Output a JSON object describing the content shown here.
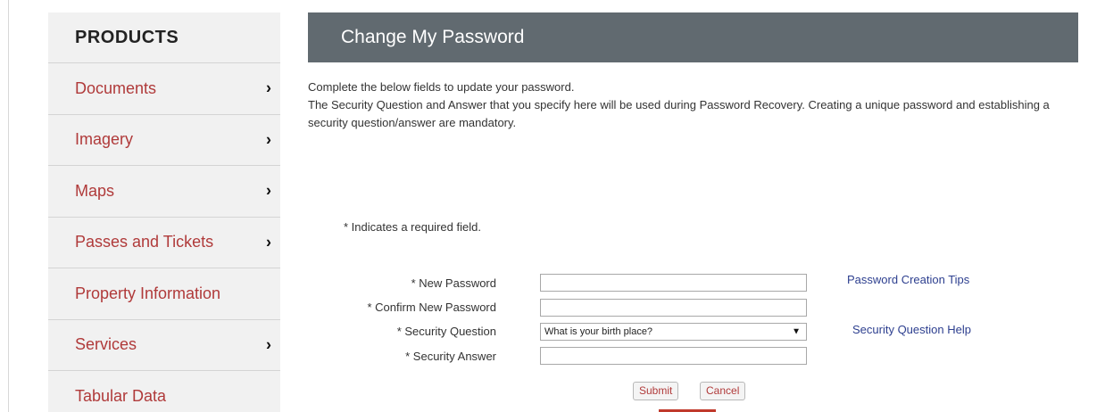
{
  "sidebar": {
    "header": "PRODUCTS",
    "items": [
      {
        "label": "Documents",
        "has_chevron": true
      },
      {
        "label": "Imagery",
        "has_chevron": true
      },
      {
        "label": "Maps",
        "has_chevron": true
      },
      {
        "label": "Passes and Tickets",
        "has_chevron": true
      },
      {
        "label": "Property Information",
        "has_chevron": false
      },
      {
        "label": "Services",
        "has_chevron": true
      },
      {
        "label": "Tabular Data",
        "has_chevron": false
      }
    ],
    "chevron_glyph": "›"
  },
  "main": {
    "title": "Change My Password",
    "intro_line1": "Complete the below fields to update your password.",
    "intro_line2": "The Security Question and Answer that you specify here will be used during Password Recovery. Creating a unique password and establishing a security question/answer are mandatory.",
    "required_note": "* Indicates a required field."
  },
  "form": {
    "new_password_label": "* New Password",
    "confirm_password_label": "* Confirm New Password",
    "security_question_label": "* Security Question",
    "security_answer_label": "* Security Answer",
    "new_password_value": "",
    "confirm_password_value": "",
    "security_question_selected": "What is your birth place?",
    "security_answer_value": "",
    "select_arrow_glyph": "▼",
    "password_tips_link": "Password Creation Tips",
    "security_help_link": "Security Question Help",
    "submit_label": "Submit",
    "cancel_label": "Cancel"
  },
  "colors": {
    "accent_red": "#b03a3a",
    "title_bar": "#616a70",
    "link_blue": "#2d3f8f",
    "sidebar_bg": "#f1f1f1"
  }
}
